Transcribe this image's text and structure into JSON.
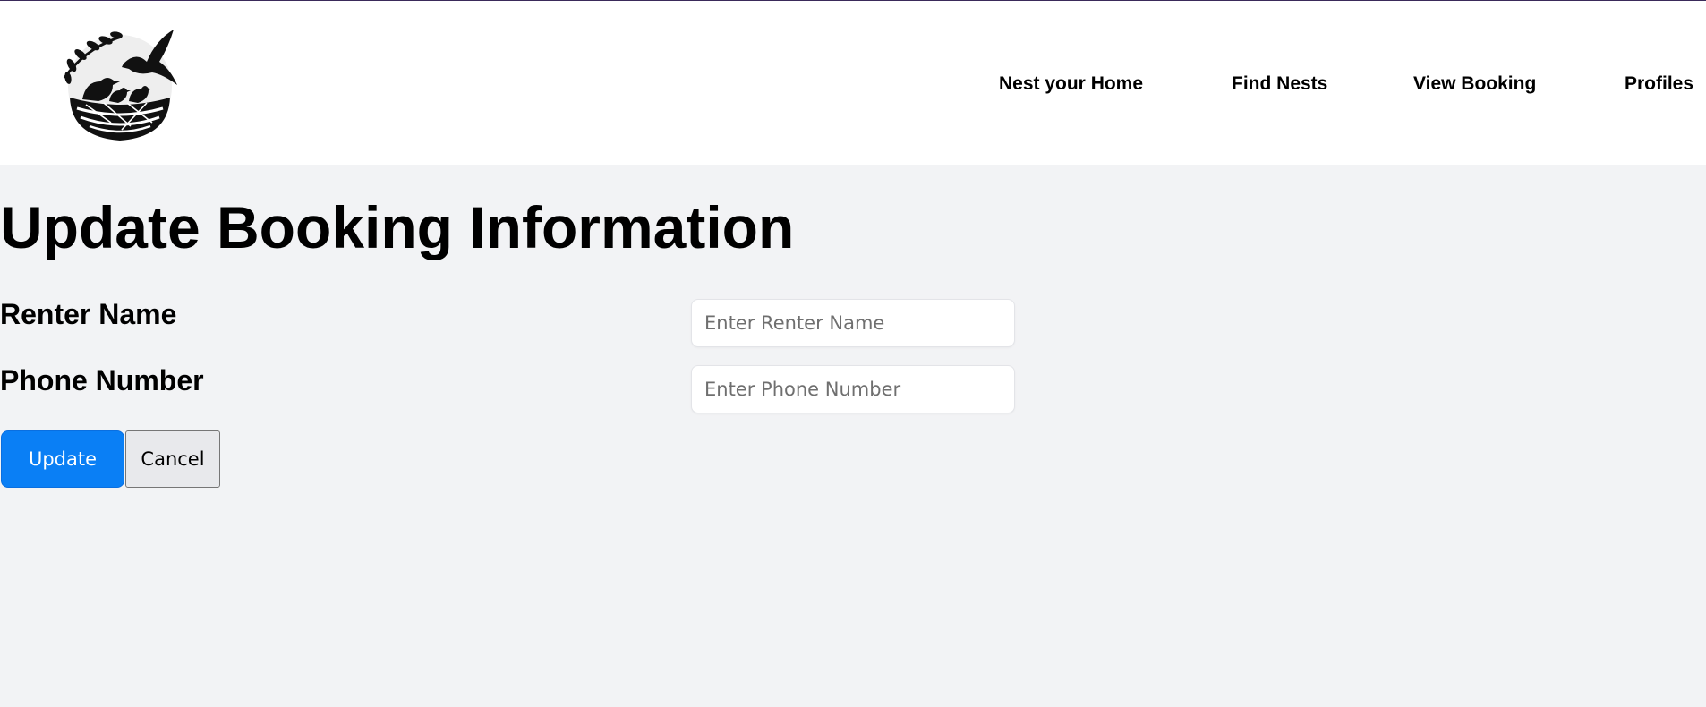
{
  "header": {
    "logo_icon": "bird-nest-logo-icon",
    "nav": [
      {
        "label": "Nest your Home"
      },
      {
        "label": "Find Nests"
      },
      {
        "label": "View Booking"
      },
      {
        "label": "Profiles"
      }
    ]
  },
  "main": {
    "title": "Update Booking Information",
    "fields": [
      {
        "label": "Renter Name",
        "value": "",
        "placeholder": "Enter Renter Name"
      },
      {
        "label": "Phone Number",
        "value": "",
        "placeholder": "Enter Phone Number"
      }
    ],
    "buttons": {
      "update_label": "Update",
      "cancel_label": "Cancel"
    }
  },
  "colors": {
    "page_background": "#f2f3f5",
    "header_background": "#ffffff",
    "primary_button": "#0a7ff5",
    "secondary_button": "#e8e9ec"
  }
}
